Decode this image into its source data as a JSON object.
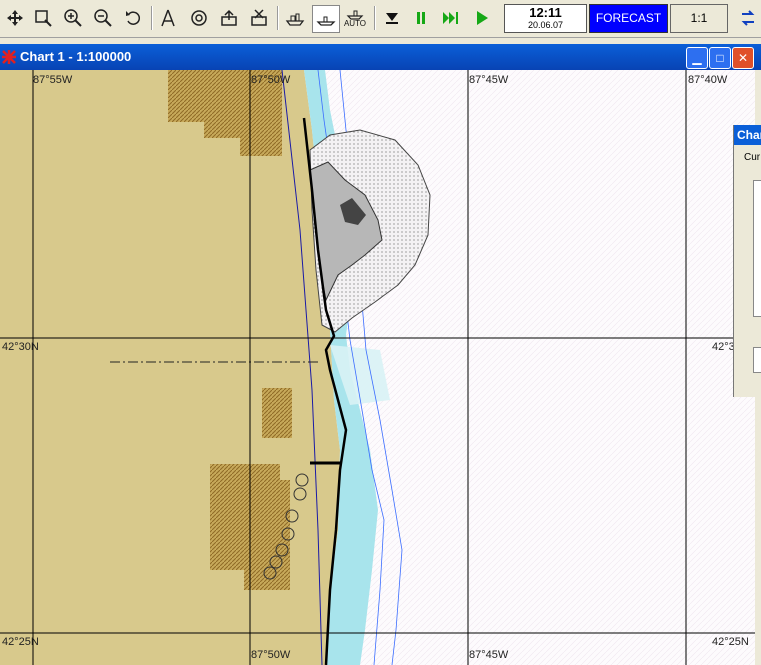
{
  "toolbar": {
    "buttons": [
      {
        "name": "move-icon"
      },
      {
        "name": "zoom-window-icon"
      },
      {
        "name": "zoom-in-icon"
      },
      {
        "name": "zoom-out-icon"
      },
      {
        "name": "undo-icon"
      },
      {
        "name": "compass-icon"
      },
      {
        "name": "target-icon"
      },
      {
        "name": "export-icon"
      },
      {
        "name": "delete-icon"
      },
      {
        "name": "ship-icon"
      },
      {
        "name": "ship-track-icon"
      },
      {
        "name": "ship-auto-icon"
      },
      {
        "name": "stop-icon"
      },
      {
        "name": "pause-icon"
      },
      {
        "name": "fast-forward-icon"
      },
      {
        "name": "play-icon"
      }
    ],
    "auto_label": "AUTO",
    "clock_time": "12:11",
    "clock_date": "20.06.07",
    "forecast_label": "FORECAST",
    "scale_label": "1:1"
  },
  "window": {
    "title": "Chart 1 - 1:100000"
  },
  "chart": {
    "lon_labels_top": [
      "87°55W",
      "87°50W",
      "87°45W",
      "87°40W"
    ],
    "lon_labels_bottom": [
      "87°50W",
      "87°45W"
    ],
    "lat_labels_left": [
      "42°30N",
      "42°25N"
    ],
    "lat_labels_right": [
      "42°3",
      "42°25N"
    ],
    "colors": {
      "land": "#d8c98c",
      "land_hatch": "#b8963e",
      "shallow": "#a8e4ec",
      "deep": "#fdfbfd",
      "grid": "#000000"
    }
  },
  "subwindow": {
    "title": "Char",
    "label": "Cur"
  }
}
